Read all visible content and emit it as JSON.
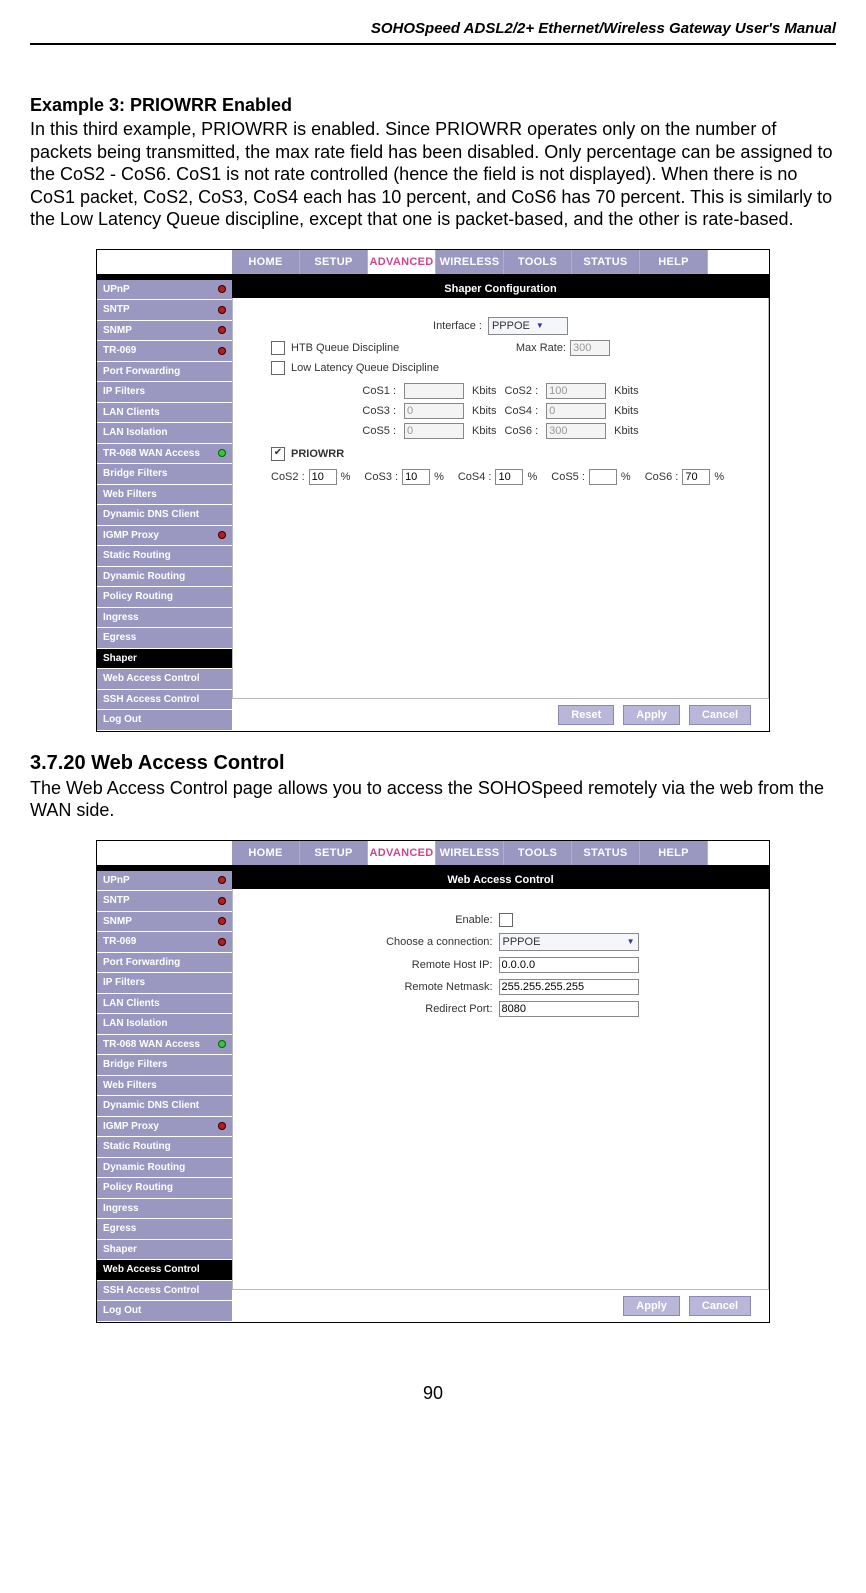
{
  "doc": {
    "header": "SOHOSpeed ADSL2/2+ Ethernet/Wireless Gateway User's Manual",
    "example_title": "Example 3: PRIOWRR Enabled",
    "example_body": "In this third example, PRIOWRR is enabled. Since PRIOWRR operates only on the number of packets being transmitted, the max rate field has been disabled. Only percentage can be assigned to the CoS2 - CoS6. CoS1 is not rate controlled (hence the field is not displayed). When there is no CoS1 packet, CoS2, CoS3, CoS4 each has 10 percent, and CoS6 has 70 percent. This is similarly to the Low Latency Queue discipline, except that one is packet-based, and the other is rate-based.",
    "sub_title": "3.7.20 Web Access Control",
    "sub_body": "The Web Access Control page allows you to access the SOHOSpeed remotely via the web from the WAN side.",
    "page_num": "90"
  },
  "tabs": {
    "home": "HOME",
    "setup": "SETUP",
    "advanced": "ADVANCED",
    "wireless": "WIRELESS",
    "tools": "TOOLS",
    "status": "STATUS",
    "help": "HELP"
  },
  "sidebar": {
    "upnp": "UPnP",
    "sntp": "SNTP",
    "snmp": "SNMP",
    "tr069": "TR-069",
    "portfwd": "Port Forwarding",
    "ipfilters": "IP Filters",
    "lanclients": "LAN Clients",
    "laniso": "LAN Isolation",
    "tr068wan": "TR-068 WAN Access",
    "bridgef": "Bridge Filters",
    "webf": "Web Filters",
    "ddns": "Dynamic DNS Client",
    "igmp": "IGMP Proxy",
    "staticr": "Static Routing",
    "dynr": "Dynamic Routing",
    "policyr": "Policy Routing",
    "ingress": "Ingress",
    "egress": "Egress",
    "shaper": "Shaper",
    "webacc": "Web Access Control",
    "sshacc": "SSH Access Control",
    "logout": "Log Out"
  },
  "shaper": {
    "title": "Shaper Configuration",
    "interface_lbl": "Interface :",
    "interface_val": "PPPOE",
    "htb_lbl": "HTB Queue Discipline",
    "maxrate_lbl": "Max Rate:",
    "maxrate_val": "300",
    "llq_lbl": "Low Latency Queue Discipline",
    "cos1_lbl": "CoS1 :",
    "cos1_val": "",
    "cos1_unit": "Kbits",
    "cos2_lbl": "CoS2 :",
    "cos2_val": "100",
    "cos2_unit": "Kbits",
    "cos3_lbl": "CoS3 :",
    "cos3_val": "0",
    "cos3_unit": "Kbits",
    "cos4_lbl": "CoS4 :",
    "cos4_val": "0",
    "cos4_unit": "Kbits",
    "cos5_lbl": "CoS5 :",
    "cos5_val": "0",
    "cos5_unit": "Kbits",
    "cos6_lbl": "CoS6 :",
    "cos6_val": "300",
    "cos6_unit": "Kbits",
    "priowrr_lbl": "PRIOWRR",
    "pct": "%",
    "pcos2_lbl": "CoS2 :",
    "pcos2_val": "10",
    "pcos3_lbl": "CoS3 :",
    "pcos3_val": "10",
    "pcos4_lbl": "CoS4 :",
    "pcos4_val": "10",
    "pcos5_lbl": "CoS5 :",
    "pcos5_val": "",
    "pcos6_lbl": "CoS6 :",
    "pcos6_val": "70",
    "reset": "Reset",
    "apply": "Apply",
    "cancel": "Cancel"
  },
  "wac": {
    "title": "Web Access Control",
    "enable_lbl": "Enable:",
    "conn_lbl": "Choose a connection:",
    "conn_val": "PPPOE",
    "rhip_lbl": "Remote Host IP:",
    "rhip_val": "0.0.0.0",
    "rnet_lbl": "Remote Netmask:",
    "rnet_val": "255.255.255.255",
    "rport_lbl": "Redirect Port:",
    "rport_val": "8080",
    "apply": "Apply",
    "cancel": "Cancel"
  }
}
